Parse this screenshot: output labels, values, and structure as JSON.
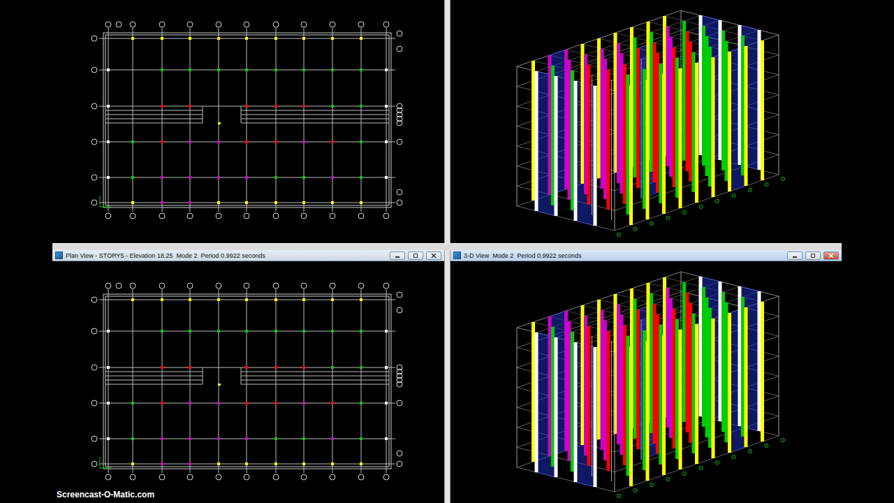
{
  "top_panes": [
    {
      "kind": "plan"
    },
    {
      "kind": "3d"
    }
  ],
  "bottom_windows": [
    {
      "kind": "plan",
      "title": "Plan View - STORY5 - Elevation 18.25  Mode 2  Period 0.9922 seconds",
      "active": false
    },
    {
      "kind": "3d",
      "title": "3-D View  Mode 2  Period 0.9922 seconds",
      "active": true
    }
  ],
  "column_rows": [
    [
      null,
      "#ffff00",
      "#ffff00",
      "#ffff00",
      "#ffff00",
      "#ffff00",
      "#ffff00",
      "#ffff00",
      "#ffff00",
      "#ffff00",
      null
    ],
    [
      "#ffffff",
      null,
      "#00cc00",
      "#00cc00",
      "#00cc00",
      "#00cc00",
      "#00cc00",
      "#00cc00",
      "#00cc00",
      "#00cc00",
      "#ffffff"
    ],
    [
      "#ffffff",
      null,
      "#ff0000",
      "#ff0000",
      null,
      "#ff0000",
      "#ff0000",
      "#ff0000",
      "#00cc00",
      "#00cc00",
      "#ffffff"
    ],
    [
      "#ffffff",
      "#00cc00",
      "#ff0000",
      "#cc00cc",
      "#cc00cc",
      "#ff0000",
      "#ff0000",
      "#cc00cc",
      "#ff0000",
      "#00cc00",
      "#ffffff"
    ],
    [
      "#ffffff",
      "#00cc00",
      "#cc00cc",
      "#cc00cc",
      "#cc00cc",
      "#cc00cc",
      "#00cc00",
      "#00cc00",
      "#cc00cc",
      "#00cc00",
      "#ffffff"
    ],
    [
      null,
      "#ffff00",
      "#cc00cc",
      "#cc00cc",
      "#ffff00",
      "#ffff00",
      "#ffff00",
      "#ffff00",
      "#ffff00",
      "#ffff00",
      null
    ]
  ],
  "watermark": "Screencast-O-Matic.com"
}
